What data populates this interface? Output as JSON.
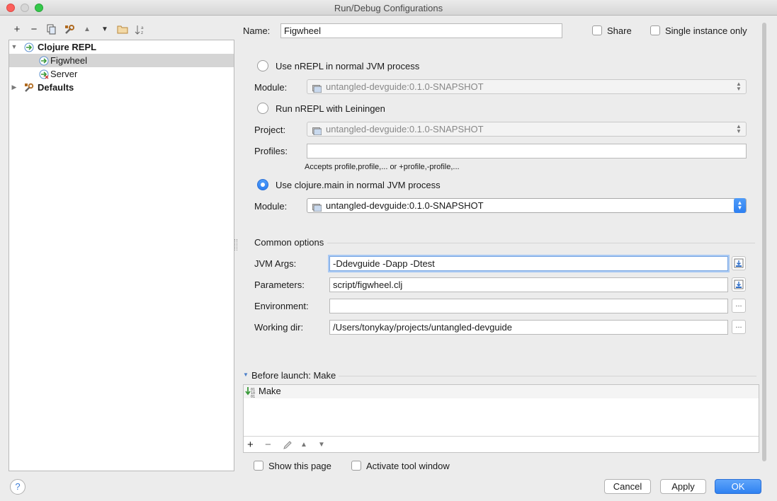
{
  "window": {
    "title": "Run/Debug Configurations"
  },
  "toolbar": {
    "add": "+",
    "remove": "−",
    "up": "▲",
    "down": "▼"
  },
  "tree": {
    "items": [
      {
        "label": "Clojure REPL",
        "icon": "clojure-repl-icon",
        "expanded": true
      },
      {
        "label": "Figwheel",
        "icon": "clojure-repl-icon",
        "selected": true
      },
      {
        "label": "Server",
        "icon": "clojure-repl-icon"
      },
      {
        "label": "Defaults",
        "icon": "wrench-icon",
        "expanded": false
      }
    ]
  },
  "form": {
    "name_label": "Name:",
    "name_value": "Figwheel",
    "share_label": "Share",
    "single_instance_label": "Single instance only",
    "radio_nrepl_jvm": "Use nREPL in normal JVM process",
    "module_label": "Module:",
    "module_value": "untangled-devguide:0.1.0-SNAPSHOT",
    "radio_nrepl_lein": "Run nREPL with Leiningen",
    "project_label": "Project:",
    "project_value": "untangled-devguide:0.1.0-SNAPSHOT",
    "profiles_label": "Profiles:",
    "profiles_value": "",
    "profiles_hint": "Accepts profile,profile,... or +profile,-profile,...",
    "radio_clojure_main": "Use clojure.main in normal JVM process",
    "module2_label": "Module:",
    "module2_value": "untangled-devguide:0.1.0-SNAPSHOT"
  },
  "common": {
    "header": "Common options",
    "jvm_args_label": "JVM Args:",
    "jvm_args_value": "-Ddevguide -Dapp -Dtest",
    "parameters_label": "Parameters:",
    "parameters_value": "script/figwheel.clj",
    "environment_label": "Environment:",
    "environment_value": "",
    "working_dir_label": "Working dir:",
    "working_dir_value": "/Users/tonykay/projects/untangled-devguide",
    "ellipsis": "..."
  },
  "before_launch": {
    "header": "Before launch: Make",
    "items": [
      {
        "label": "Make",
        "icon": "make-icon"
      }
    ],
    "add": "+",
    "remove": "−",
    "up": "▲",
    "down": "▼"
  },
  "footer": {
    "show_page_label": "Show this page",
    "activate_tool_label": "Activate tool window",
    "help": "?",
    "cancel": "Cancel",
    "apply": "Apply",
    "ok": "OK"
  },
  "colors": {
    "accent": "#2f82f1",
    "selection": "#d5d5d5"
  }
}
